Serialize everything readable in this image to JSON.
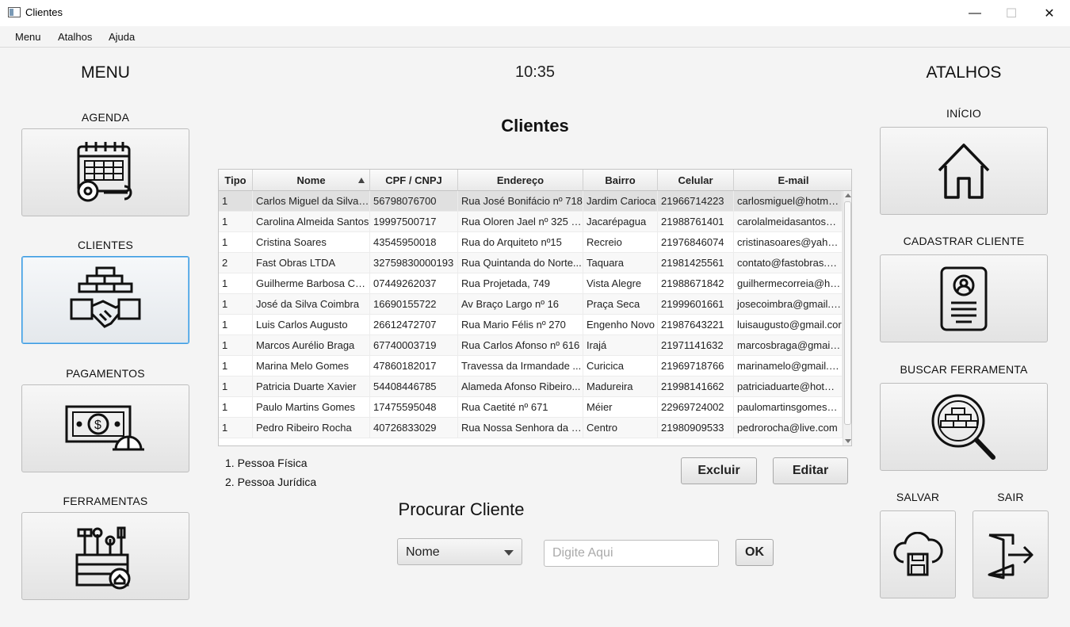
{
  "window": {
    "title": "Clientes"
  },
  "menubar": {
    "items": [
      "Menu",
      "Atalhos",
      "Ajuda"
    ]
  },
  "left_panel": {
    "heading": "MENU",
    "buttons": [
      {
        "label": "AGENDA",
        "icon": "calendar-gear-icon"
      },
      {
        "label": "CLIENTES",
        "icon": "handshake-bricks-icon"
      },
      {
        "label": "PAGAMENTOS",
        "icon": "money-helmet-icon"
      },
      {
        "label": "FERRAMENTAS",
        "icon": "toolbox-icon"
      }
    ]
  },
  "center": {
    "clock": "10:35",
    "page_title": "Clientes",
    "table": {
      "columns": [
        "Tipo",
        "Nome",
        "CPF / CNPJ",
        "Endereço",
        "Bairro",
        "Celular",
        "E-mail"
      ],
      "sorted_column": "Nome",
      "rows": [
        [
          "1",
          "Carlos Miguel da Silva ...",
          "56798076700",
          "Rua José Bonifácio nº 718",
          "Jardim Carioca",
          "21966714223",
          "carlosmiguel@hotmail..."
        ],
        [
          "1",
          "Carolina Almeida Santos",
          "19997500717",
          "Rua Oloren Jael nº 325 a...",
          "Jacarépagua",
          "21988761401",
          "carolalmeidasantos@h..."
        ],
        [
          "1",
          "Cristina Soares",
          "43545950018",
          "Rua do Arquiteto nº15",
          "Recreio",
          "21976846074",
          "cristinasoares@yahoo..."
        ],
        [
          "2",
          "Fast Obras LTDA",
          "32759830000193",
          "Rua Quintanda do Norte...",
          "Taquara",
          "21981425561",
          "contato@fastobras.co..."
        ],
        [
          "1",
          "Guilherme Barbosa Co...",
          "07449262037",
          "Rua Projetada, 749",
          "Vista Alegre",
          "21988671842",
          "guilhermecorreia@hot..."
        ],
        [
          "1",
          "José da Silva Coimbra",
          "16690155722",
          "Av Braço Largo nº 16",
          "Praça Seca",
          "21999601661",
          "josecoimbra@gmail.co..."
        ],
        [
          "1",
          "Luis Carlos Augusto",
          "26612472707",
          "Rua Mario Félis nº 270",
          "Engenho Novo",
          "21987643221",
          "luisaugusto@gmail.cor"
        ],
        [
          "1",
          "Marcos Aurélio Braga",
          "67740003719",
          "Rua Carlos Afonso nº 616",
          "Irajá",
          "21971141632",
          "marcosbraga@gmail.c..."
        ],
        [
          "1",
          "Marina Melo Gomes",
          "47860182017",
          "Travessa da Irmandade ...",
          "Curicica",
          "21969718766",
          "marinamelo@gmail.co..."
        ],
        [
          "1",
          "Patricia Duarte Xavier",
          "54408446785",
          "Alameda Afonso Ribeiro...",
          "Madureira",
          "21998141662",
          "patriciaduarte@hotma..."
        ],
        [
          "1",
          "Paulo Martins Gomes",
          "17475595048",
          "Rua Caetité nº 671",
          "Méier",
          "22969724002",
          "paulomartinsgomes@..."
        ],
        [
          "1",
          "Pedro Ribeiro Rocha",
          "40726833029",
          "Rua Nossa Senhora da C...",
          "Centro",
          "21980909533",
          "pedrorocha@live.com"
        ]
      ]
    },
    "legend": [
      "1. Pessoa Física",
      "2. Pessoa Jurídica"
    ],
    "buttons": {
      "delete": "Excluir",
      "edit": "Editar"
    },
    "search": {
      "title": "Procurar Cliente",
      "field_selected": "Nome",
      "placeholder": "Digite Aqui",
      "ok": "OK"
    }
  },
  "right_panel": {
    "heading": "ATALHOS",
    "buttons": [
      {
        "label": "INÍCIO",
        "icon": "home-icon"
      },
      {
        "label": "CADASTRAR CLIENTE",
        "icon": "id-card-icon"
      },
      {
        "label": "BUSCAR FERRAMENTA",
        "icon": "magnifier-bricks-icon"
      },
      {
        "label": "SALVAR",
        "icon": "cloud-save-icon"
      },
      {
        "label": "SAIR",
        "icon": "exit-door-icon"
      }
    ]
  },
  "colors": {
    "focus_border": "#3d9be0",
    "window_bg": "#f4f4f4",
    "selected_row": "#e0e0e0"
  }
}
